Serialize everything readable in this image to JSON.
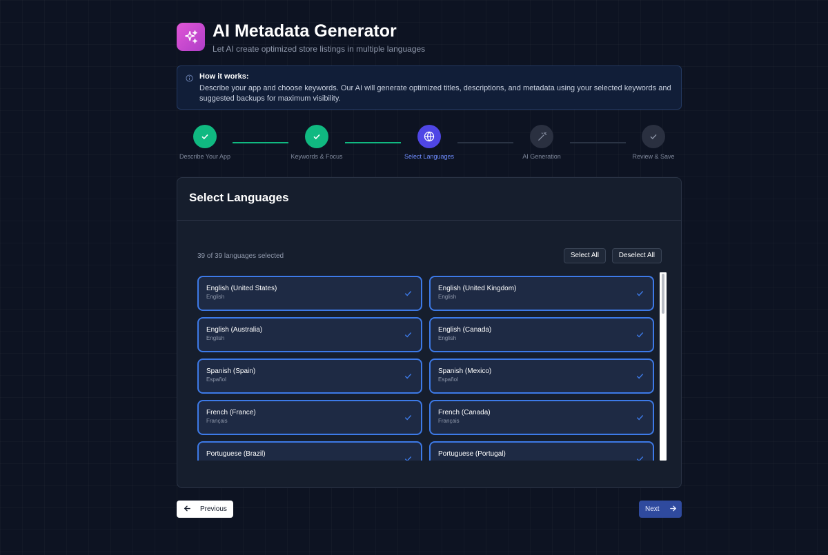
{
  "app": {
    "title": "AI Metadata Generator",
    "subtitle": "Let AI create optimized store listings in multiple languages",
    "logo_icon": "sparkles-icon",
    "logo_color": "#d24fd2"
  },
  "info": {
    "icon": "info-icon",
    "title": "How it works:",
    "text": "Describe your app and choose keywords. Our AI will generate optimized titles, descriptions, and metadata using your selected keywords and suggested backups for maximum visibility."
  },
  "stepper": {
    "steps": [
      {
        "label": "Describe Your App",
        "status": "done",
        "icon": "check-icon"
      },
      {
        "label": "Keywords & Focus",
        "status": "done",
        "icon": "check-icon"
      },
      {
        "label": "Select Languages",
        "status": "active",
        "icon": "globe-icon"
      },
      {
        "label": "AI Generation",
        "status": "pending",
        "icon": "magic-wand-icon"
      },
      {
        "label": "Review & Save",
        "status": "pending",
        "icon": "check-icon"
      }
    ],
    "colors": {
      "done": "#10b981",
      "active": "#4f46e5",
      "pending": "#2a3040"
    }
  },
  "panel": {
    "title": "Select Languages",
    "count_text": "39 of 39 languages selected",
    "select_all": "Select All",
    "deselect_all": "Deselect All",
    "languages": [
      {
        "name": "English (United States)",
        "native": "English",
        "selected": true
      },
      {
        "name": "English (United Kingdom)",
        "native": "English",
        "selected": true
      },
      {
        "name": "English (Australia)",
        "native": "English",
        "selected": true
      },
      {
        "name": "English (Canada)",
        "native": "English",
        "selected": true
      },
      {
        "name": "Spanish (Spain)",
        "native": "Español",
        "selected": true
      },
      {
        "name": "Spanish (Mexico)",
        "native": "Español",
        "selected": true
      },
      {
        "name": "French (France)",
        "native": "Français",
        "selected": true
      },
      {
        "name": "French (Canada)",
        "native": "Français",
        "selected": true
      },
      {
        "name": "Portuguese (Brazil)",
        "native": "",
        "selected": true
      },
      {
        "name": "Portuguese (Portugal)",
        "native": "",
        "selected": true
      }
    ]
  },
  "nav": {
    "previous": "Previous",
    "next": "Next",
    "accent": "#3d7ae8"
  }
}
